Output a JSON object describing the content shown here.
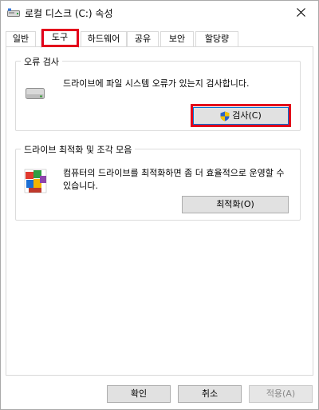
{
  "window": {
    "title": "로컬 디스크 (C:) 속성",
    "close_label": "✕"
  },
  "tabs": [
    {
      "label": "일반",
      "active": false
    },
    {
      "label": "도구",
      "active": true
    },
    {
      "label": "하드웨어",
      "active": false
    },
    {
      "label": "공유",
      "active": false
    },
    {
      "label": "보안",
      "active": false
    },
    {
      "label": "할당량",
      "active": false
    }
  ],
  "error_check": {
    "title": "오류 검사",
    "description": "드라이브에 파일 시스템 오류가 있는지 검사합니다.",
    "button_label": "검사(C)"
  },
  "optimize": {
    "title": "드라이브 최적화 및 조각 모음",
    "description": "컴퓨터의 드라이브를 최적화하면 좀 더 효율적으로 운영할 수 있습니다.",
    "button_label": "최적화(O)"
  },
  "footer": {
    "ok_label": "확인",
    "cancel_label": "취소",
    "apply_label": "적용(A)"
  },
  "colors": {
    "highlight": "#e3001b",
    "accent": "#0078d7"
  }
}
